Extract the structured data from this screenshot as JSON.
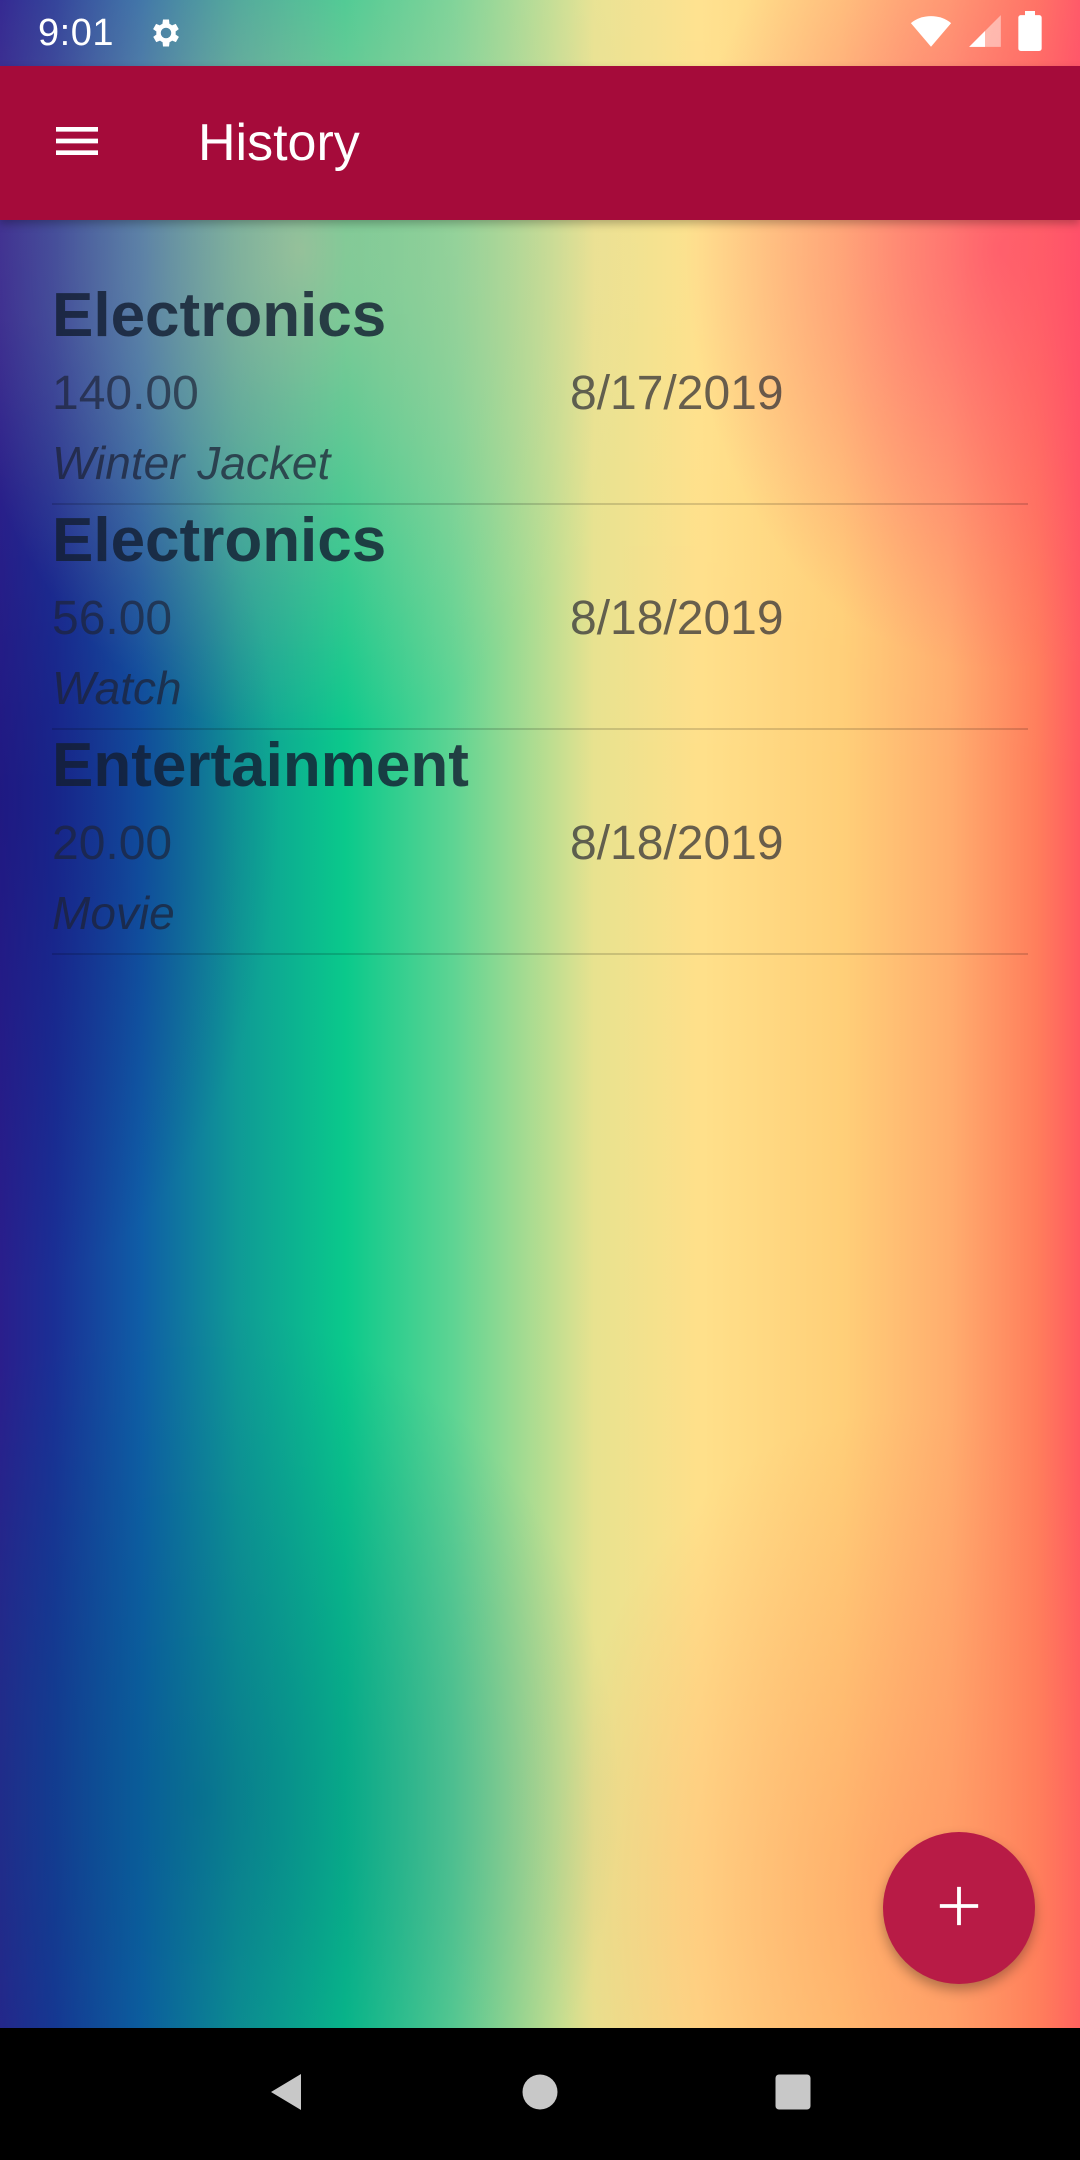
{
  "status": {
    "time": "9:01",
    "icons": [
      "gear-icon",
      "wifi-icon",
      "cell-signal-icon",
      "battery-icon"
    ]
  },
  "appbar": {
    "title": "History",
    "menu_icon": "menu-icon",
    "color": "#a50b3a"
  },
  "history": [
    {
      "category": "Electronics",
      "amount": "140.00",
      "date": "8/17/2019",
      "description": "Winter Jacket"
    },
    {
      "category": "Electronics",
      "amount": "56.00",
      "date": "8/18/2019",
      "description": "Watch"
    },
    {
      "category": "Entertainment",
      "amount": "20.00",
      "date": "8/18/2019",
      "description": "Movie"
    }
  ],
  "fab": {
    "icon": "plus-icon",
    "color": "#b81b46"
  },
  "navbar": {
    "icons": [
      "back-icon",
      "home-icon",
      "recents-icon"
    ]
  }
}
